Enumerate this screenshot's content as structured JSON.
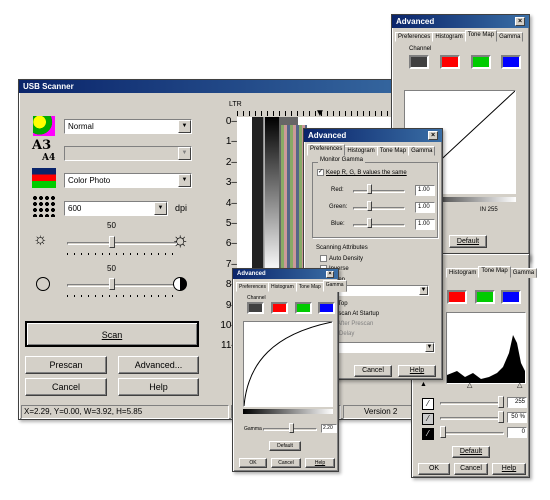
{
  "main": {
    "title": "USB Scanner",
    "profile_value": "Normal",
    "paper_value": "",
    "mode_value": "Color Photo",
    "dpi_value": "600",
    "dpi_unit": "dpi",
    "brightness_value": "50",
    "contrast_value": "50",
    "ruler_unit": "LTR",
    "ruler_numbers": [
      "0",
      "1",
      "2",
      "3",
      "4",
      "5",
      "6",
      "7",
      "8",
      "9",
      "10",
      "11"
    ],
    "scan_label": "Scan",
    "prescan_label": "Prescan",
    "advanced_label": "Advanced...",
    "cancel_label": "Cancel",
    "help_label": "Help",
    "status_coords": "X=2.29, Y=0.00, W=3.92, H=5.85",
    "status_mid": "2",
    "status_version": "Version 2",
    "preview_filmstrip_text": "KODAK Gray Scale"
  },
  "adv_right": {
    "title": "Advanced",
    "tabs": [
      "Preferences",
      "Histogram",
      "Tone Map",
      "Gamma"
    ],
    "active_tab": "Tone Map",
    "channel_label": "Channel",
    "in_label": "IN 255",
    "default_label": "Default"
  },
  "adv_center": {
    "title": "Advanced",
    "tabs": [
      "Preferences",
      "Histogram",
      "Tone Map",
      "Gamma"
    ],
    "monitor_gamma_label": "Monitor Gamma",
    "keep_label": "Keep R, G, B values the same",
    "red_label": "Red:",
    "green_label": "Green:",
    "blue_label": "Blue:",
    "red_value": "1.00",
    "green_value": "1.00",
    "blue_value": "1.00",
    "scan_attr_label": "Scanning Attributes",
    "auto_density": "Auto Density",
    "inverse": "Inverse",
    "screen": "reen",
    "combo_value": "one",
    "on_top": "n Top",
    "prescan_startup": "rescan At Startup",
    "after_prescan": "After Prescan",
    "delay": "Delay",
    "cancel_label": "Cancel",
    "help_label": "Help"
  },
  "adv_gamma": {
    "title": "Advanced",
    "tabs": [
      "Preferences",
      "Histogram",
      "Tone Map",
      "Gamma"
    ],
    "channel_label": "Channel",
    "gamma_label": "Gamma",
    "gamma_value": "2.20",
    "default_label": "Default",
    "ok_label": "OK",
    "cancel_label": "Cancel",
    "help_label": "Help"
  },
  "adv_hist": {
    "tabs": [
      "Histogram",
      "Tone Map",
      "Gamma"
    ],
    "v1": "255",
    "v2": "50",
    "v2_unit": "%",
    "v3": "0",
    "default_label": "Default",
    "ok_label": "OK",
    "cancel_label": "Cancel",
    "help_label": "Help"
  },
  "colors": {
    "titlebar": "#0a246a",
    "face": "#d4d0c8",
    "channel_black": "#404040",
    "channel_red": "#ff0000",
    "channel_green": "#00cc00",
    "channel_blue": "#0000ff"
  }
}
